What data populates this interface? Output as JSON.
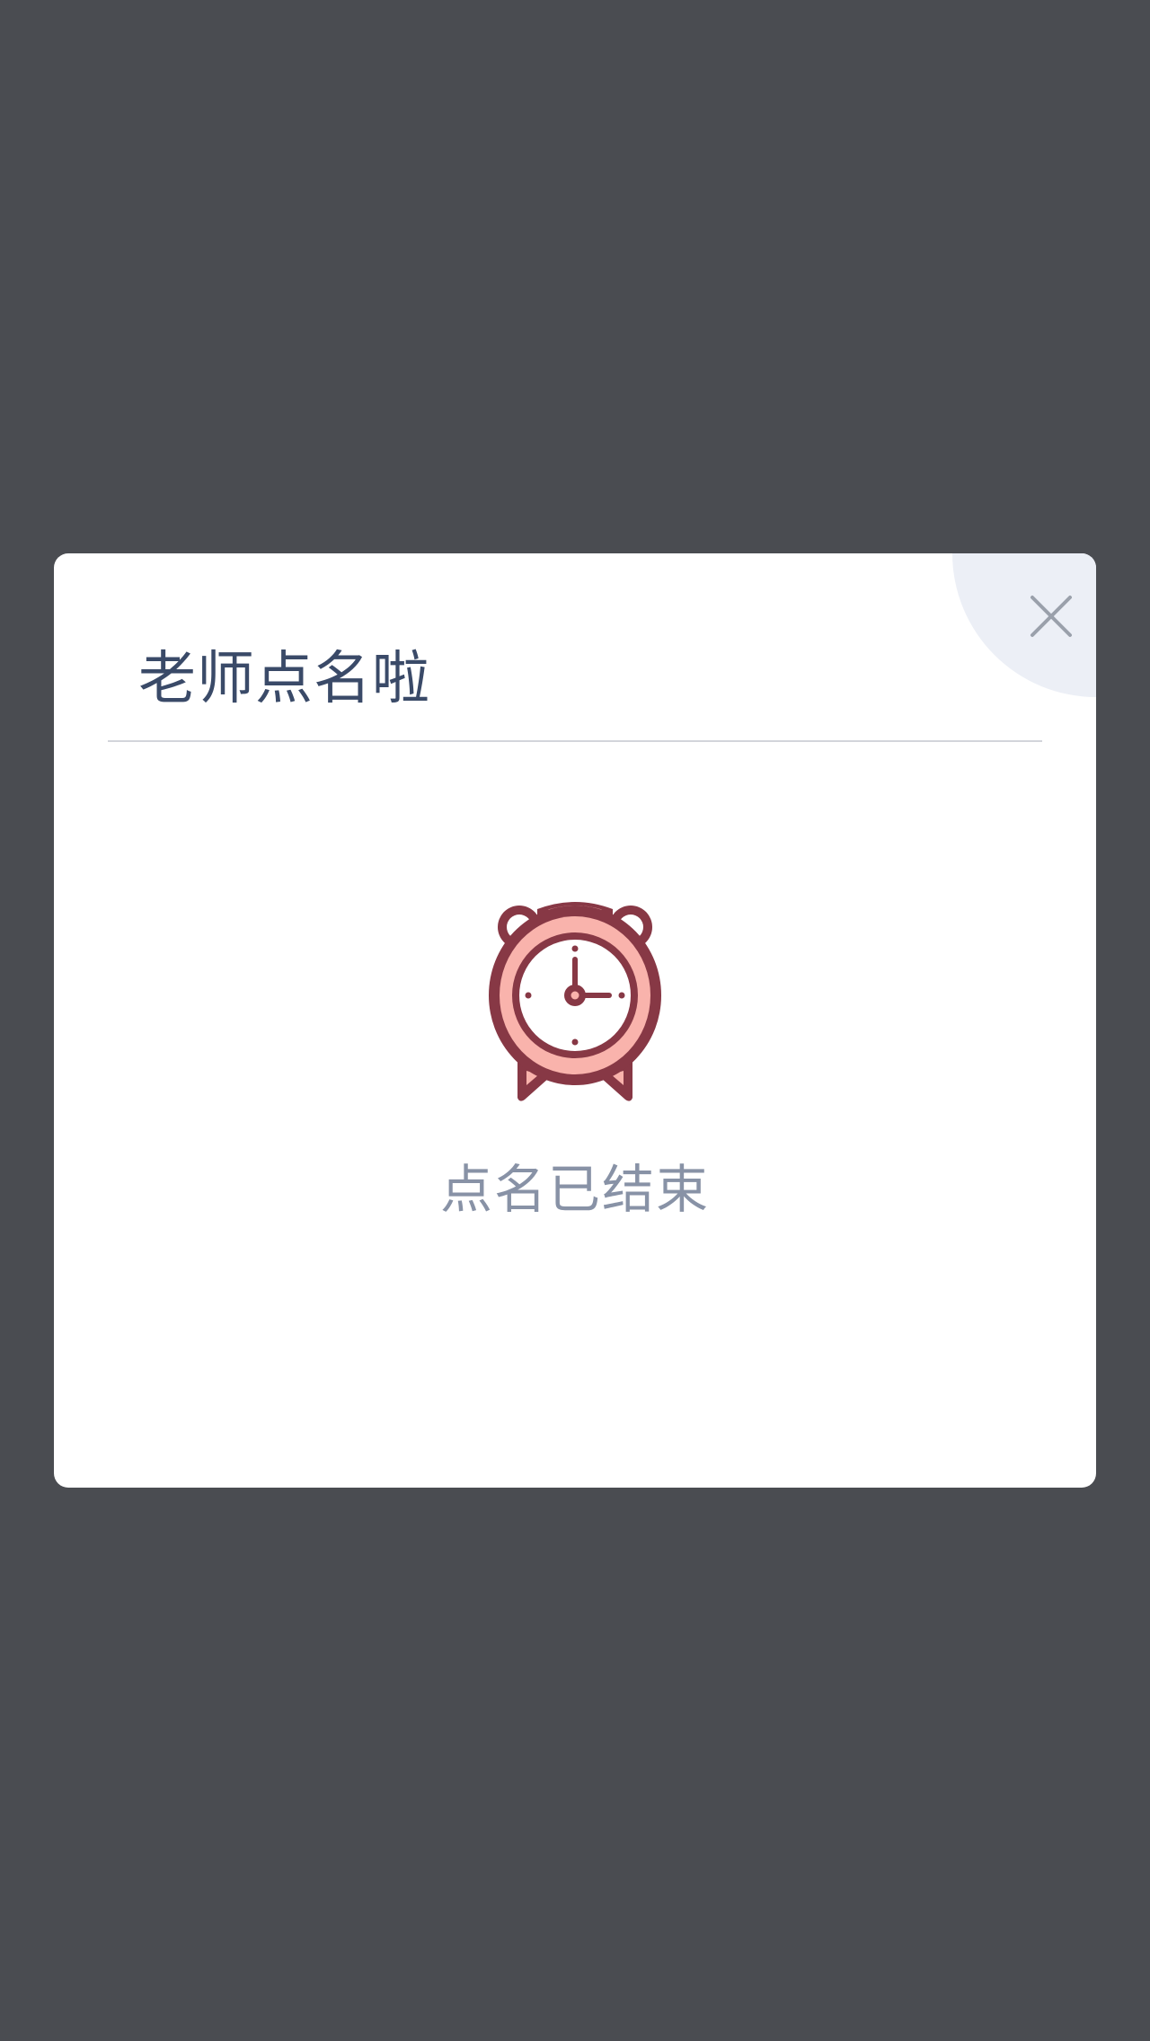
{
  "dialog": {
    "title": "老师点名啦",
    "status": "点名已结束",
    "close_icon": "close-icon",
    "status_icon": "alarm-clock-icon"
  },
  "colors": {
    "overlay": "#4a4c51",
    "modal_bg": "#ffffff",
    "title": "#3a4a68",
    "status_text": "#8892a6",
    "corner_bubble": "#eceff6",
    "clock_outline": "#873845",
    "clock_fill": "#f9b3ac"
  }
}
